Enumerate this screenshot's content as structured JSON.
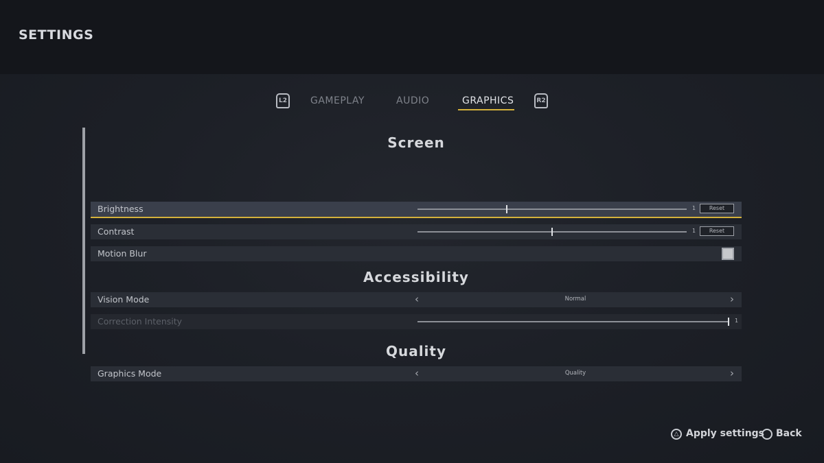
{
  "header": {
    "title": "SETTINGS"
  },
  "tabs": {
    "left_shoulder": "L2",
    "right_shoulder": "R2",
    "items": [
      {
        "label": "GAMEPLAY",
        "active": false
      },
      {
        "label": "AUDIO",
        "active": false
      },
      {
        "label": "GRAPHICS",
        "active": true
      }
    ]
  },
  "accent_color": "#d4b13b",
  "sections": {
    "screen": {
      "title": "Screen",
      "brightness": {
        "label": "Brightness",
        "value": "1",
        "level": 0.33,
        "reset": "Reset"
      },
      "contrast": {
        "label": "Contrast",
        "value": "1",
        "level": 0.5,
        "reset": "Reset"
      },
      "motion_blur": {
        "label": "Motion Blur",
        "checked": true
      }
    },
    "accessibility": {
      "title": "Accessibility",
      "vision_mode": {
        "label": "Vision Mode",
        "value": "Normal",
        "prev": "‹",
        "next": "›"
      },
      "correction_intensity": {
        "label": "Correction Intensity",
        "value": "1",
        "level": 1.0
      }
    },
    "quality": {
      "title": "Quality",
      "graphics_mode": {
        "label": "Graphics Mode",
        "value": "Quality",
        "prev": "‹",
        "next": "›"
      }
    }
  },
  "footer": {
    "apply_glyph": "△",
    "apply_label": "Apply settings",
    "back_glyph": "○",
    "back_label": "Back"
  }
}
